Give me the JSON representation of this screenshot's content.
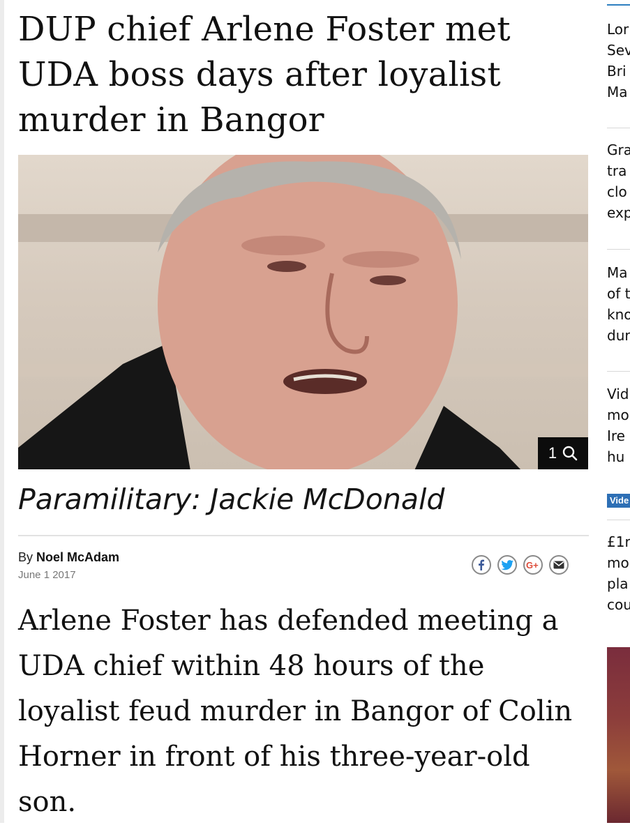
{
  "article": {
    "headline": "DUP chief Arlene Foster met UDA boss days after loyalist murder in Bangor",
    "photo_count": "1",
    "caption": "Paramilitary: Jackie McDonald",
    "byline_prefix": "By",
    "author": "Noel McAdam",
    "date": "June 1 2017",
    "body": "Arlene Foster has defended meeting a UDA chief within 48 hours of the loyalist feud murder in Bangor of Colin Horner in front of his three-year-old son."
  },
  "share": {
    "icons": [
      "facebook-icon",
      "twitter-icon",
      "google-plus-icon",
      "email-icon"
    ],
    "colors": {
      "facebook": "#3b5998",
      "twitter": "#1da1f2",
      "google_plus": "#dd4b39",
      "email": "#333333"
    }
  },
  "sidebar": {
    "items": [
      {
        "lines": [
          "Lor",
          "Sev",
          "Bri",
          "Ma"
        ]
      },
      {
        "lines": [
          "Gra",
          "tra",
          "clo",
          "exp"
        ]
      },
      {
        "lines": [
          "Ma",
          "of t",
          "kno",
          "dur"
        ]
      },
      {
        "lines": [
          "Vid",
          "mo",
          "Ire",
          "hu"
        ],
        "tag": "Vide"
      },
      {
        "lines": [
          "£1r",
          "mo",
          "pla",
          "cou"
        ]
      }
    ]
  },
  "colors": {
    "accent": "#2d7fc0",
    "video_tag": "#2d6fb5"
  }
}
